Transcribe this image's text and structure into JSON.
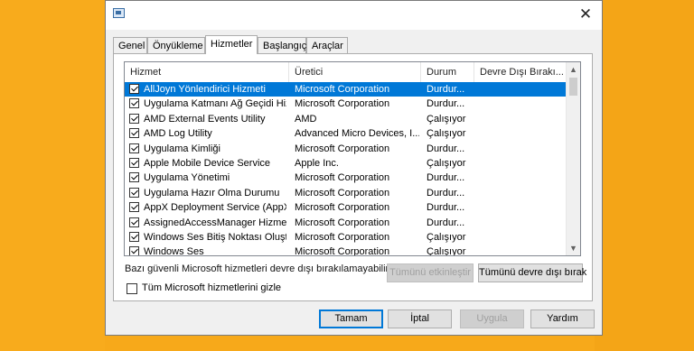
{
  "window": {
    "close_symbol": "✕",
    "app_icon": "msconfig-icon",
    "tabs": [
      {
        "label": "Genel",
        "active": false
      },
      {
        "label": "Önyükleme",
        "active": false
      },
      {
        "label": "Hizmetler",
        "active": true
      },
      {
        "label": "Başlangıç",
        "active": false
      },
      {
        "label": "Araçlar",
        "active": false
      }
    ]
  },
  "services": {
    "columns": [
      "Hizmet",
      "Üretici",
      "Durum",
      "Devre Dışı Bırakı..."
    ],
    "rows": [
      {
        "name": "AllJoyn Yönlendirici Hizmeti",
        "maker": "Microsoft Corporation",
        "status": "Durdur...",
        "date": "",
        "checked": true,
        "selected": true
      },
      {
        "name": "Uygulama Katmanı Ağ Geçidi Hiz...",
        "maker": "Microsoft Corporation",
        "status": "Durdur...",
        "date": "",
        "checked": true,
        "selected": false
      },
      {
        "name": "AMD External Events Utility",
        "maker": "AMD",
        "status": "Çalışıyor",
        "date": "",
        "checked": true,
        "selected": false
      },
      {
        "name": "AMD Log Utility",
        "maker": "Advanced Micro Devices, I...",
        "status": "Çalışıyor",
        "date": "",
        "checked": true,
        "selected": false
      },
      {
        "name": "Uygulama Kimliği",
        "maker": "Microsoft Corporation",
        "status": "Durdur...",
        "date": "",
        "checked": true,
        "selected": false
      },
      {
        "name": "Apple Mobile Device Service",
        "maker": "Apple Inc.",
        "status": "Çalışıyor",
        "date": "",
        "checked": true,
        "selected": false
      },
      {
        "name": "Uygulama Yönetimi",
        "maker": "Microsoft Corporation",
        "status": "Durdur...",
        "date": "",
        "checked": true,
        "selected": false
      },
      {
        "name": "Uygulama Hazır Olma Durumu",
        "maker": "Microsoft Corporation",
        "status": "Durdur...",
        "date": "",
        "checked": true,
        "selected": false
      },
      {
        "name": "AppX Deployment Service (AppX...",
        "maker": "Microsoft Corporation",
        "status": "Durdur...",
        "date": "",
        "checked": true,
        "selected": false
      },
      {
        "name": "AssignedAccessManager Hizmeti",
        "maker": "Microsoft Corporation",
        "status": "Durdur...",
        "date": "",
        "checked": true,
        "selected": false
      },
      {
        "name": "Windows Ses Bitiş Noktası Oluşt...",
        "maker": "Microsoft Corporation",
        "status": "Çalışıyor",
        "date": "",
        "checked": true,
        "selected": false
      },
      {
        "name": "Windows Ses",
        "maker": "Microsoft Corporation",
        "status": "Çalışıyor",
        "date": "",
        "checked": true,
        "selected": false
      }
    ]
  },
  "note": "Bazı güvenli Microsoft hizmetleri devre dışı bırakılamayabilir.",
  "buttons": {
    "enable_all": "Tümünü etkinleştir",
    "disable_all": "Tümünü devre dışı bırak",
    "ok": "Tamam",
    "cancel": "İptal",
    "apply": "Uygula",
    "help": "Yardım"
  },
  "hide_ms": {
    "label": "Tüm Microsoft hizmetlerini gizle",
    "checked": false
  },
  "colors": {
    "selection": "#0078d7",
    "background": "#f7a91a"
  }
}
